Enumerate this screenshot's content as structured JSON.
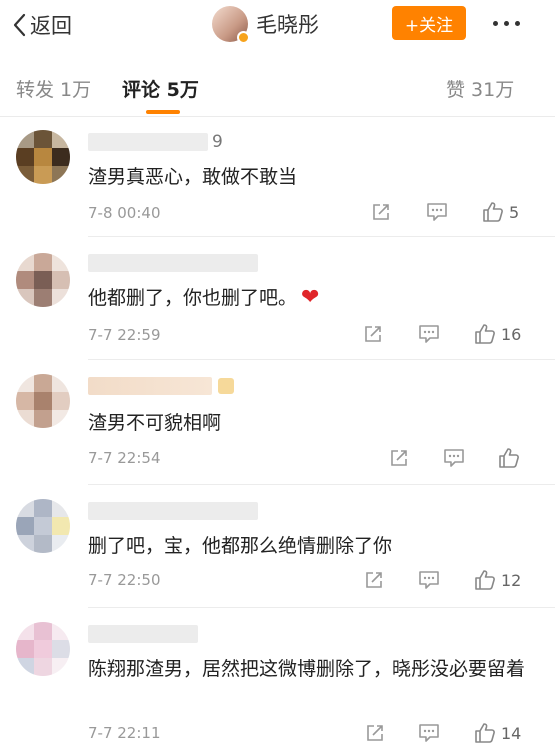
{
  "header": {
    "back_label": "返回",
    "profile_name": "毛晓彤",
    "follow_label": "+关注"
  },
  "tabs": {
    "repost": "转发 1万",
    "comments": "评论 5万",
    "likes": "赞 31万"
  },
  "comments": [
    {
      "name_visible": "9",
      "text": "渣男真恶心，敢做不敢当",
      "time": "7-8 00:40",
      "likes": "5"
    },
    {
      "name_visible": "",
      "text": "他都删了，你也删了吧。",
      "time": "7-7 22:59",
      "likes": "16"
    },
    {
      "name_visible": "",
      "text": "渣男不可貌相啊",
      "time": "7-7 22:54",
      "likes": ""
    },
    {
      "name_visible": "",
      "text": "删了吧，宝，他都那么绝情删除了你",
      "time": "7-7 22:50",
      "likes": "12"
    },
    {
      "name_visible": "",
      "text": "陈翔那渣男，居然把这微博删除了，晓彤没必要留着",
      "time": "7-7 22:11",
      "likes": "14"
    }
  ],
  "colors": {
    "accent": "#ff8200",
    "heart": "#e0262a"
  }
}
